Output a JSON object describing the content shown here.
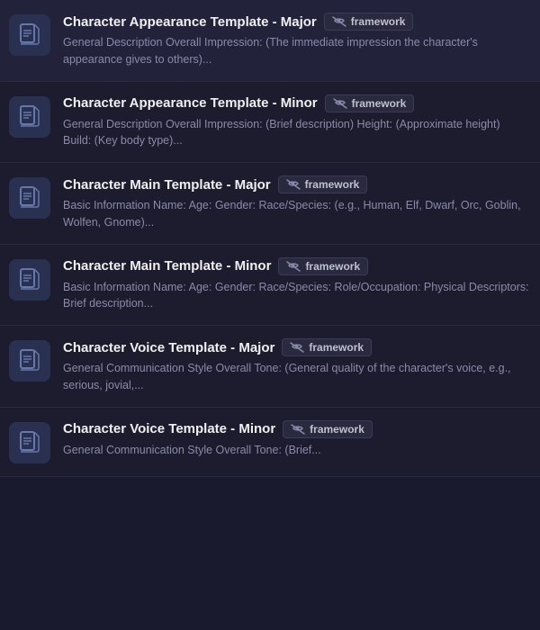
{
  "items": [
    {
      "id": "char-appearance-major",
      "title": "Character Appearance Template - Major",
      "badge_label": "framework",
      "description": "General Description Overall Impression: (The immediate impression the character's appearance gives to others)..."
    },
    {
      "id": "char-appearance-minor",
      "title": "Character Appearance Template - Minor",
      "badge_label": "framework",
      "description": "General Description Overall Impression: (Brief description) Height: (Approximate height) Build: (Key body type)..."
    },
    {
      "id": "char-main-major",
      "title": "Character Main Template - Major",
      "badge_label": "framework",
      "description": "Basic Information Name: Age: Gender: Race/Species: (e.g., Human, Elf, Dwarf, Orc, Goblin, Wolfen, Gnome)..."
    },
    {
      "id": "char-main-minor",
      "title": "Character Main Template - Minor",
      "badge_label": "framework",
      "description": "Basic Information Name: Age: Gender: Race/Species: Role/Occupation: Physical Descriptors: Brief description..."
    },
    {
      "id": "char-voice-major",
      "title": "Character Voice Template - Major",
      "badge_label": "framework",
      "description": "General Communication Style Overall Tone: (General quality of the character's voice, e.g., serious, jovial,..."
    },
    {
      "id": "char-voice-minor",
      "title": "Character Voice Template - Minor",
      "badge_label": "framework",
      "description": "General Communication Style Overall Tone: (Brief..."
    }
  ],
  "icons": {
    "document": "🗋",
    "eye_slash": "⊘"
  }
}
